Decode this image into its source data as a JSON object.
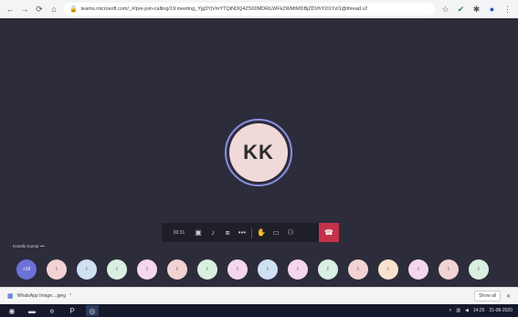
{
  "browser": {
    "url": "teams.microsoft.com/_#/pre-join-calling/19:meeting_Yjg3YjVmYTQtNDQ4ZS00MDRiLWFkZWMtMDBjZDVhY2I1YzI1@thread.v2",
    "icons": [
      "back-icon",
      "forward-icon",
      "reload-icon",
      "home-icon",
      "lock-icon",
      "star-icon",
      "check-icon",
      "extension-icon",
      "profile-icon"
    ]
  },
  "meeting": {
    "avatar_initials": "KK",
    "timer": "00:31",
    "presenter_name": "Kranthi Kumar  •••",
    "participant_overflow": "+16",
    "participant_initial": "I",
    "participant_colors": [
      "#6d72d8",
      "#f1d3d3",
      "#cfe0f3",
      "#d8efe1",
      "#f4d6ef",
      "#f1d3d3",
      "#d8efe1",
      "#f4d6ef",
      "#cfe0f3",
      "#f4d6ef",
      "#d8efe1",
      "#f1d3d3",
      "#f7e2cf",
      "#f4d6ef",
      "#f1d3d3",
      "#d8efe1"
    ],
    "hangup_color": "#c4314b"
  },
  "downloads": {
    "file_name": "WhatsApp Image....jpeg",
    "show_all": "Show all"
  },
  "taskbar": {
    "time": "14:25",
    "date": "31-08-2020"
  }
}
